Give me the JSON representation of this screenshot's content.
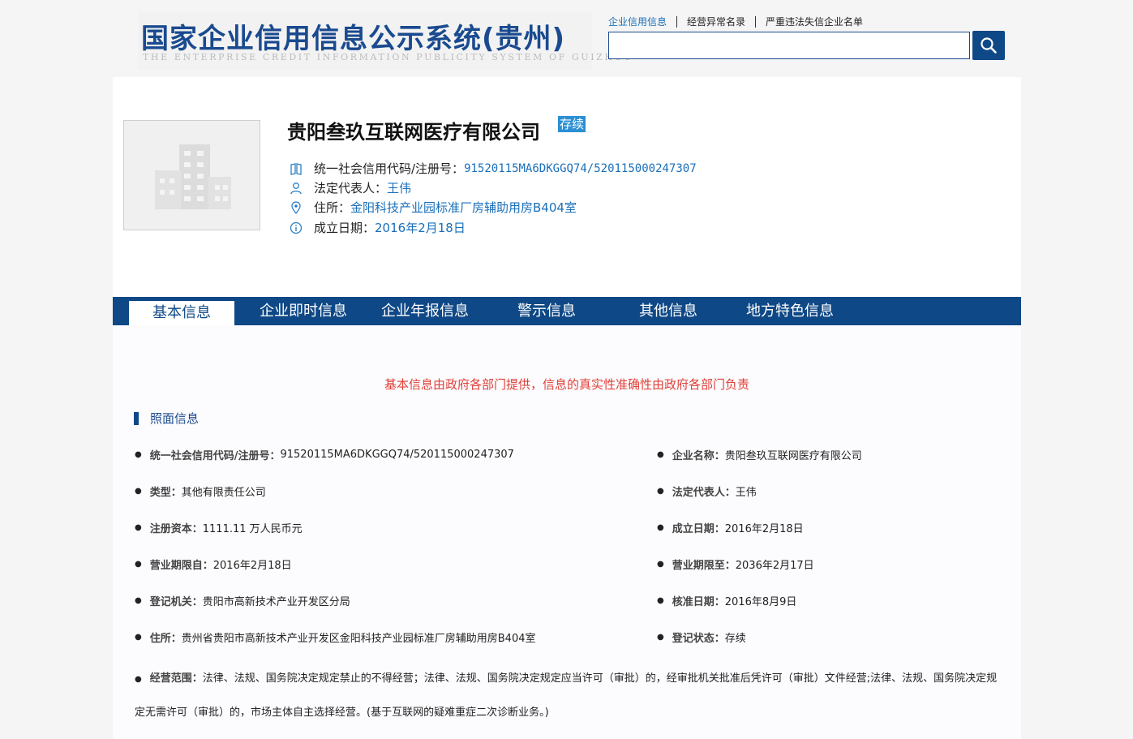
{
  "header": {
    "logo_cn": "国家企业信用信息公示系统(贵州)",
    "logo_en": "THE ENTERPRISE CREDIT INFORMATION PUBLICITY SYSTEM OF GUIZHOU",
    "search_tabs": [
      "企业信用信息",
      "经营异常名录",
      "严重违法失信企业名单"
    ],
    "search_placeholder": "",
    "search_icon": "search-icon"
  },
  "profile": {
    "company_name": "贵阳叁玖互联网医疗有限公司",
    "status": "存续",
    "credit_code_label": "统一社会信用代码/注册号：",
    "credit_code": "91520115MA6DKGGQ74/520115000247307",
    "legal_rep_label": "法定代表人：",
    "legal_rep": "王伟",
    "address_label": "住所：",
    "address": "金阳科技产业园标准厂房辅助用房B404室",
    "founded_label": "成立日期：",
    "founded": "2016年2月18日"
  },
  "nav": {
    "tabs": [
      "基本信息",
      "企业即时信息",
      "企业年报信息",
      "警示信息",
      "其他信息",
      "地方特色信息"
    ],
    "active": "基本信息"
  },
  "content": {
    "notice": "基本信息由政府各部门提供，信息的真实性准确性由政府各部门负责",
    "section_title": "照面信息",
    "fields_left": [
      {
        "label": "统一社会信用代码/注册号：",
        "value": "91520115MA6DKGGQ74/520115000247307"
      },
      {
        "label": "类型：",
        "value": "其他有限责任公司"
      },
      {
        "label": "注册资本：",
        "value": "1111.11 万人民币元"
      },
      {
        "label": "营业期限自：",
        "value": "2016年2月18日"
      },
      {
        "label": "登记机关：",
        "value": "贵阳市高新技术产业开发区分局"
      },
      {
        "label": "住所：",
        "value": "贵州省贵阳市高新技术产业开发区金阳科技产业园标准厂房辅助用房B404室"
      }
    ],
    "fields_right": [
      {
        "label": "企业名称：",
        "value": "贵阳叁玖互联网医疗有限公司"
      },
      {
        "label": "法定代表人：",
        "value": "王伟"
      },
      {
        "label": "成立日期：",
        "value": "2016年2月18日"
      },
      {
        "label": "营业期限至：",
        "value": "2036年2月17日"
      },
      {
        "label": "核准日期：",
        "value": "2016年8月9日"
      },
      {
        "label": "登记状态：",
        "value": "存续"
      }
    ],
    "scope_label": "经营范围：",
    "scope_value": "法律、法规、国务院决定规定禁止的不得经营；法律、法规、国务院决定规定应当许可（审批）的，经审批机关批准后凭许可（审批）文件经营;法律、法规、国务院决定规定无需许可（审批）的，市场主体自主选择经营。(基于互联网的疑难重症二次诊断业务。)"
  }
}
